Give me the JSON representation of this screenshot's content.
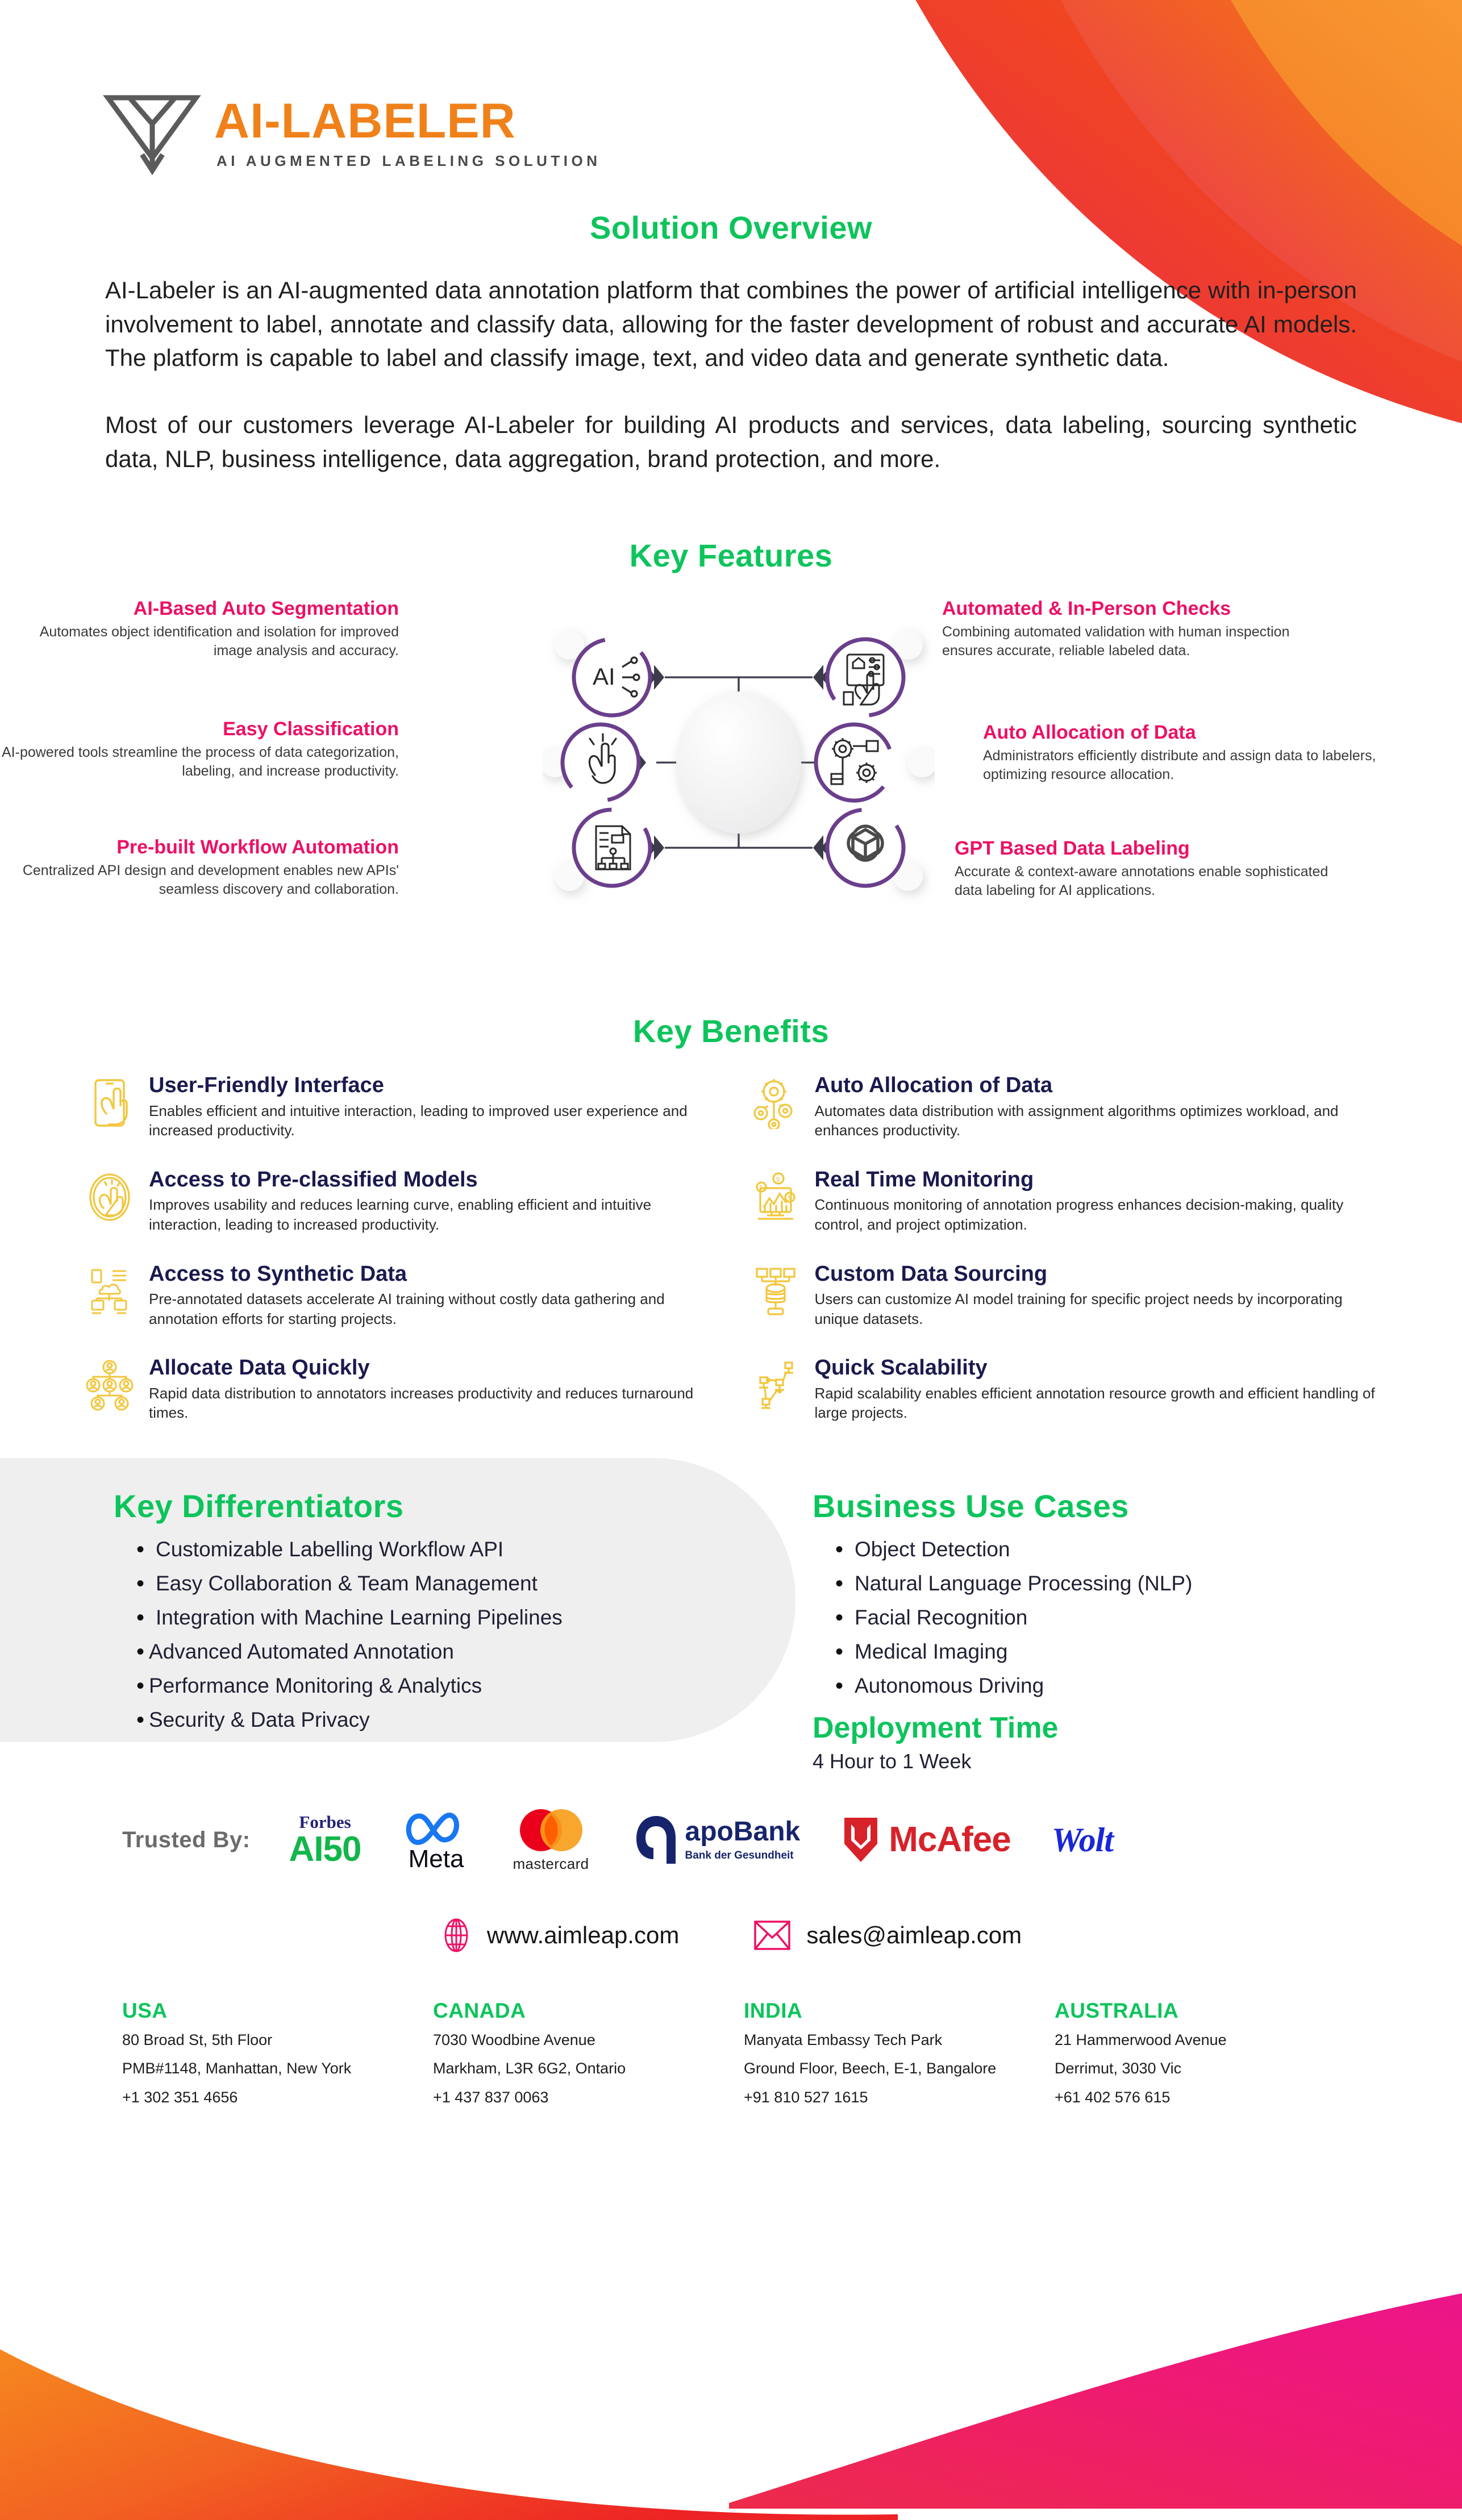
{
  "brand": {
    "logo_word": "AI-LABELER",
    "tagline": "AI AUGMENTED LABELING SOLUTION",
    "orange": "#F0811A",
    "green": "#0DC45C",
    "pink": "#EC1165",
    "navy": "#1B1A4E",
    "yellow": "#F2C63D",
    "purple": "#6B3F8C"
  },
  "overview": {
    "heading": "Solution Overview",
    "paragraph_1": "AI-Labeler is an AI-augmented data annotation platform that combines the power of artificial intelligence with in-person involvement to label, annotate and classify data, allowing for the faster development of robust and accurate AI models. The platform is capable to label and classify image, text, and video data and generate synthetic data.",
    "paragraph_2": "Most of our customers leverage AI-Labeler for building AI products and services, data labeling, sourcing synthetic data, NLP, business intelligence, data aggregation, brand protection, and more."
  },
  "features": {
    "heading": "Key Features",
    "items": [
      {
        "title": "AI-Based Auto Segmentation",
        "desc": "Automates object identification and isolation for improved image analysis and accuracy.",
        "icon": "ai-chip-icon"
      },
      {
        "title": "Easy Classification",
        "desc": "AI-powered tools streamline the process of data categorization, labeling, and increase productivity.",
        "icon": "tap-hand-icon"
      },
      {
        "title": "Pre-built Workflow Automation",
        "desc": "Centralized API design and development enables new APIs' seamless discovery and collaboration.",
        "icon": "workflow-document-icon"
      },
      {
        "title": "Automated & In-Person Checks",
        "desc": "Combining automated validation with human inspection ensures accurate, reliable labeled data.",
        "icon": "tablet-hand-icon"
      },
      {
        "title": "Auto Allocation of Data",
        "desc": "Administrators efficiently distribute and assign data to labelers, optimizing resource allocation.",
        "icon": "gears-network-icon"
      },
      {
        "title": "GPT Based Data Labeling",
        "desc": "Accurate & context-aware annotations enable sophisticated data labeling for AI applications.",
        "icon": "openai-logo-icon"
      }
    ]
  },
  "benefits": {
    "heading": "Key Benefits",
    "items": [
      {
        "title": "User-Friendly Interface",
        "desc": "Enables efficient and intuitive interaction, leading to improved user experience and increased productivity.",
        "icon": "phone-touch-icon"
      },
      {
        "title": "Auto Allocation of Data",
        "desc": "Automates data distribution with assignment algorithms optimizes workload, and enhances productivity.",
        "icon": "gear-nodes-icon"
      },
      {
        "title": "Access to Pre-classified Models",
        "desc": "Improves usability and reduces learning curve, enabling efficient and intuitive interaction, leading to increased productivity.",
        "icon": "thumbs-up-circle-icon"
      },
      {
        "title": "Real Time Monitoring",
        "desc": "Continuous monitoring of annotation progress enhances decision-making, quality control, and project optimization.",
        "icon": "monitor-chart-icon"
      },
      {
        "title": "Access to Synthetic Data",
        "desc": "Pre-annotated datasets accelerate AI training without costly data gathering and annotation efforts for starting projects.",
        "icon": "cloud-data-icon"
      },
      {
        "title": "Custom Data Sourcing",
        "desc": "Users can customize AI model training for specific project needs by incorporating unique datasets.",
        "icon": "data-stack-icon"
      },
      {
        "title": "Allocate Data Quickly",
        "desc": "Rapid data distribution to annotators increases productivity and reduces turnaround times.",
        "icon": "user-network-icon"
      },
      {
        "title": "Quick Scalability",
        "desc": "Rapid scalability enables efficient annotation resource growth and efficient handling of large projects.",
        "icon": "scaling-nodes-icon"
      }
    ]
  },
  "differentiators": {
    "heading": "Key Differentiators",
    "items": [
      "Customizable Labelling Workflow API",
      "Easy Collaboration & Team Management",
      "Integration with Machine Learning Pipelines",
      "Advanced Automated Annotation",
      "Performance Monitoring & Analytics",
      "Security & Data Privacy"
    ]
  },
  "use_cases": {
    "heading": "Business Use Cases",
    "items": [
      "Object Detection",
      "Natural Language Processing (NLP)",
      "Facial Recognition",
      "Medical Imaging",
      "Autonomous Driving"
    ],
    "deployment_heading": "Deployment Time",
    "deployment_value": "4 Hour to 1 Week"
  },
  "trusted": {
    "label": "Trusted By:",
    "logos": [
      {
        "name": "forbes-ai50-logo",
        "top": "Forbes",
        "main": "AI50"
      },
      {
        "name": "meta-logo",
        "main": "Meta"
      },
      {
        "name": "mastercard-logo",
        "main": "mastercard"
      },
      {
        "name": "apobank-logo",
        "main": "apoBank",
        "sub": "Bank der Gesundheit"
      },
      {
        "name": "mcafee-logo",
        "main": "McAfee"
      },
      {
        "name": "wolt-logo",
        "main": "Wolt"
      }
    ]
  },
  "contact": {
    "website_icon": "globe-icon",
    "website": "www.aimleap.com",
    "email_icon": "envelope-icon",
    "email": "sales@aimleap.com"
  },
  "addresses": [
    {
      "country": "USA",
      "line1": "80 Broad St, 5th Floor",
      "line2": "PMB#1148, Manhattan, New York",
      "phone": "+1 302 351 4656"
    },
    {
      "country": "CANADA",
      "line1": "7030 Woodbine Avenue",
      "line2": "Markham, L3R 6G2, Ontario",
      "phone": "+1 437 837 0063"
    },
    {
      "country": "INDIA",
      "line1": "Manyata Embassy Tech Park",
      "line2": "Ground Floor, Beech, E-1, Bangalore",
      "phone": "+91 810 527 1615"
    },
    {
      "country": "AUSTRALIA",
      "line1": "21 Hammerwood Avenue",
      "line2": "Derrimut, 3030 Vic",
      "phone": "+61 402 576 615"
    }
  ]
}
